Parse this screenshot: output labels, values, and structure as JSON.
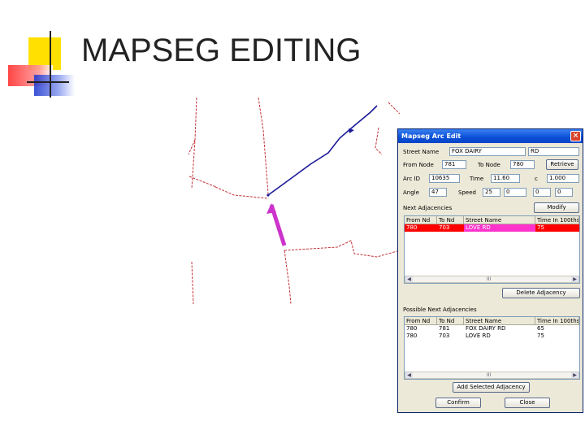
{
  "slide": {
    "title": "MAPSEG EDITING"
  },
  "map": {
    "colors": {
      "road": "#c4323a",
      "path": "#1a1a99",
      "selected": "#cc33cc"
    }
  },
  "dialog": {
    "title": "Mapseg Arc Edit",
    "close_glyph": "×",
    "street_name_label": "Street Name",
    "street_name": "FOX DAIRY",
    "street_type": "RD",
    "from_node_label": "From Node",
    "from_node": "781",
    "to_node_label": "To Node",
    "to_node": "780",
    "retrieve_label": "Retrieve",
    "arc_id_label": "Arc ID",
    "arc_id": "10635",
    "time_label": "Time",
    "time": "11.60",
    "c_label": "c",
    "c_value": "1.000",
    "angle_label": "Angle",
    "angle": "47",
    "speed_label": "Speed",
    "speed": "25",
    "speed_unit": "0",
    "extra1": "0",
    "extra2": "0",
    "modify_label": "Modify",
    "next_adj_label": "Next Adjacencies",
    "grid1_headers": [
      "From Nd",
      "To Nd",
      "Street Name",
      "Time In 100ths"
    ],
    "grid1_rows": [
      {
        "from": "780",
        "to": "703",
        "street": "LOVE RD",
        "time": "75"
      }
    ],
    "delete_adj_label": "Delete Adjacency",
    "possible_adj_label": "Possible Next Adjacencies",
    "grid2_headers": [
      "From Nd",
      "To Nd",
      "Street Name",
      "Time In 100ths"
    ],
    "grid2_rows": [
      {
        "from": "780",
        "to": "781",
        "street": "FOX DAIRY RD",
        "time": "65"
      },
      {
        "from": "780",
        "to": "703",
        "street": "LOVE RD",
        "time": "75"
      }
    ],
    "add_adj_label": "Add Selected Adjacency",
    "confirm_label": "Confirm",
    "close_label": "Close",
    "scroll_mid": "III"
  }
}
